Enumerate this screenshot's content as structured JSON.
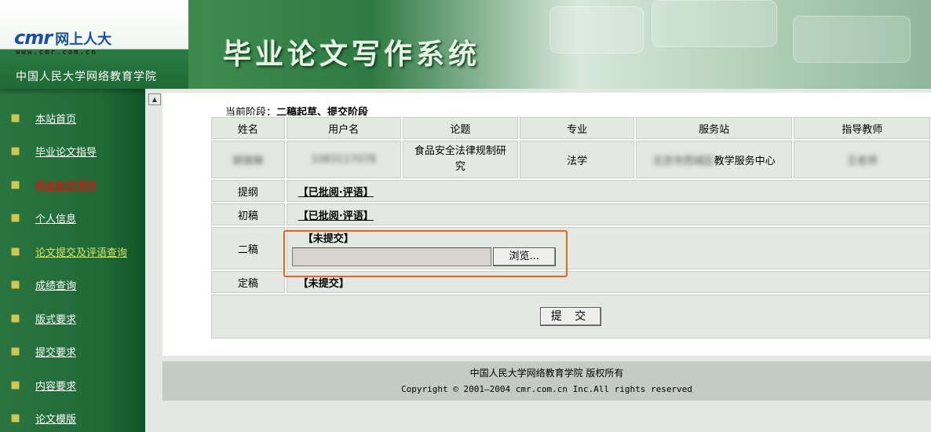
{
  "header": {
    "logo_brand": "cmr",
    "logo_cn": "网上人大",
    "logo_url": "www.cmr.com.cn",
    "school": "中国人民大学网络教育学院",
    "system_title": "毕业论文写作系统"
  },
  "sidebar": {
    "items": [
      {
        "label": "本站首页"
      },
      {
        "label": "毕业论文指导"
      },
      {
        "label": "毕业论文写作"
      },
      {
        "label": "个人信息"
      },
      {
        "label": "论文提交及评语查询"
      },
      {
        "label": "成绩查询"
      },
      {
        "label": "版式要求"
      },
      {
        "label": "提交要求"
      },
      {
        "label": "内容要求"
      },
      {
        "label": "论文模版"
      }
    ]
  },
  "main": {
    "stage_prefix": "当前阶段：",
    "stage_value": "二稿起草、提交阶段",
    "columns": [
      "姓名",
      "用户名",
      "论题",
      "专业",
      "服务站",
      "指导教师"
    ],
    "student": {
      "name": "郭晓琳",
      "username": "1083117078",
      "topic": "食品安全法律规制研究",
      "major": "法学",
      "station_blur": "北京市西城区",
      "station_suffix": "教学服务中心",
      "advisor": "王老师"
    },
    "stages": [
      {
        "label": "提纲",
        "status": "【已批阅·评语】"
      },
      {
        "label": "初稿",
        "status": "【已批阅·评语】"
      },
      {
        "label": "二稿",
        "status": "【未提交】",
        "browse": "浏览..."
      },
      {
        "label": "定稿",
        "status": "【未提交】"
      }
    ],
    "submit": "提 交"
  },
  "footer": {
    "line1": "中国人民大学网络教育学院  版权所有",
    "line2": "Copyright © 2001—2004 cmr.com.cn Inc.All rights reserved"
  },
  "colors": {
    "header_green": "#1f6b36",
    "highlight": "#e9651e",
    "active_nav": "#e01010"
  }
}
